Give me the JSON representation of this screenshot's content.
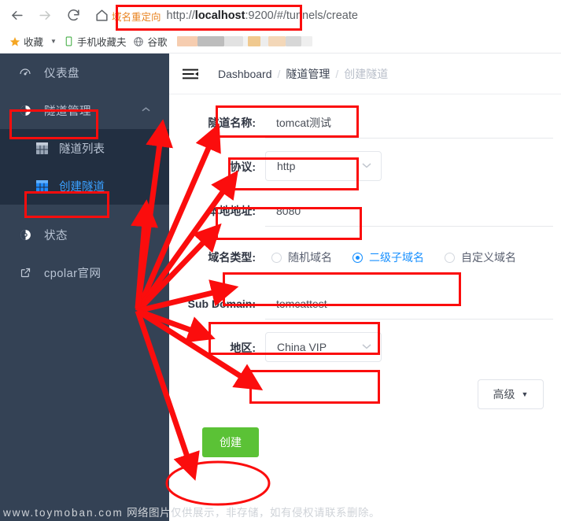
{
  "browser": {
    "back_icon": "arrow-left-icon",
    "forward_icon": "arrow-right-icon",
    "reload_icon": "reload-icon",
    "home_icon": "home-icon",
    "url_tag": "域名重定向",
    "url_scheme": "http://",
    "url_host": "localhost",
    "url_port": ":9200/",
    "url_path": "#/tunnels/create",
    "bookmarks": [
      {
        "icon": "star-icon",
        "label": "收藏"
      },
      {
        "icon": "mobile-icon",
        "label": "手机收藏夫"
      },
      {
        "icon": "globe-icon",
        "label": "谷歌"
      }
    ]
  },
  "sidebar": {
    "items": [
      {
        "icon": "dashboard-icon",
        "label": "仪表盘",
        "chevron": ""
      },
      {
        "icon": "tunnel-icon",
        "label": "隧道管理",
        "chevron": "︿"
      },
      {
        "icon": "status-icon",
        "label": "状态",
        "chevron": "﹀"
      },
      {
        "icon": "external-link-icon",
        "label": "cpolar官网",
        "chevron": ""
      }
    ],
    "submenu": [
      {
        "icon": "grid-icon",
        "label": "隧道列表",
        "active": false
      },
      {
        "icon": "grid-icon",
        "label": "创建隧道",
        "active": true
      }
    ]
  },
  "topbar": {
    "menu_icon": "hamburger-collapse-icon",
    "breadcrumbs": [
      "Dashboard",
      "隧道管理",
      "创建隧道"
    ],
    "separator": "/"
  },
  "form": {
    "tunnel_name": {
      "label": "隧道名称:",
      "value": "tomcat测试"
    },
    "protocol": {
      "label": "协议:",
      "value": "http",
      "chevron": "chevron-down-icon"
    },
    "local_addr": {
      "label": "本地地址:",
      "value": "8080"
    },
    "domain_type": {
      "label": "域名类型:",
      "options": [
        {
          "label": "随机域名",
          "selected": false
        },
        {
          "label": "二级子域名",
          "selected": true
        },
        {
          "label": "自定义域名",
          "selected": false
        }
      ]
    },
    "sub_domain": {
      "label": "Sub Domain:",
      "value": "tomcattest"
    },
    "region": {
      "label": "地区:",
      "value": "China VIP",
      "chevron": "chevron-down-icon"
    },
    "advanced_label": "高级",
    "advanced_caret": "▼",
    "create_label": "创建"
  },
  "watermark": {
    "site": "www.toymoban.com",
    "text": "网络图片仅供展示，非存储，如有侵权请联系删除。"
  },
  "colors": {
    "annotation_red": "#fb0d0d",
    "sidebar_bg": "#344255",
    "submenu_bg": "#222f41",
    "accent_blue": "#1890ff",
    "create_green": "#5bc236",
    "url_tag_orange": "#e8821e"
  }
}
